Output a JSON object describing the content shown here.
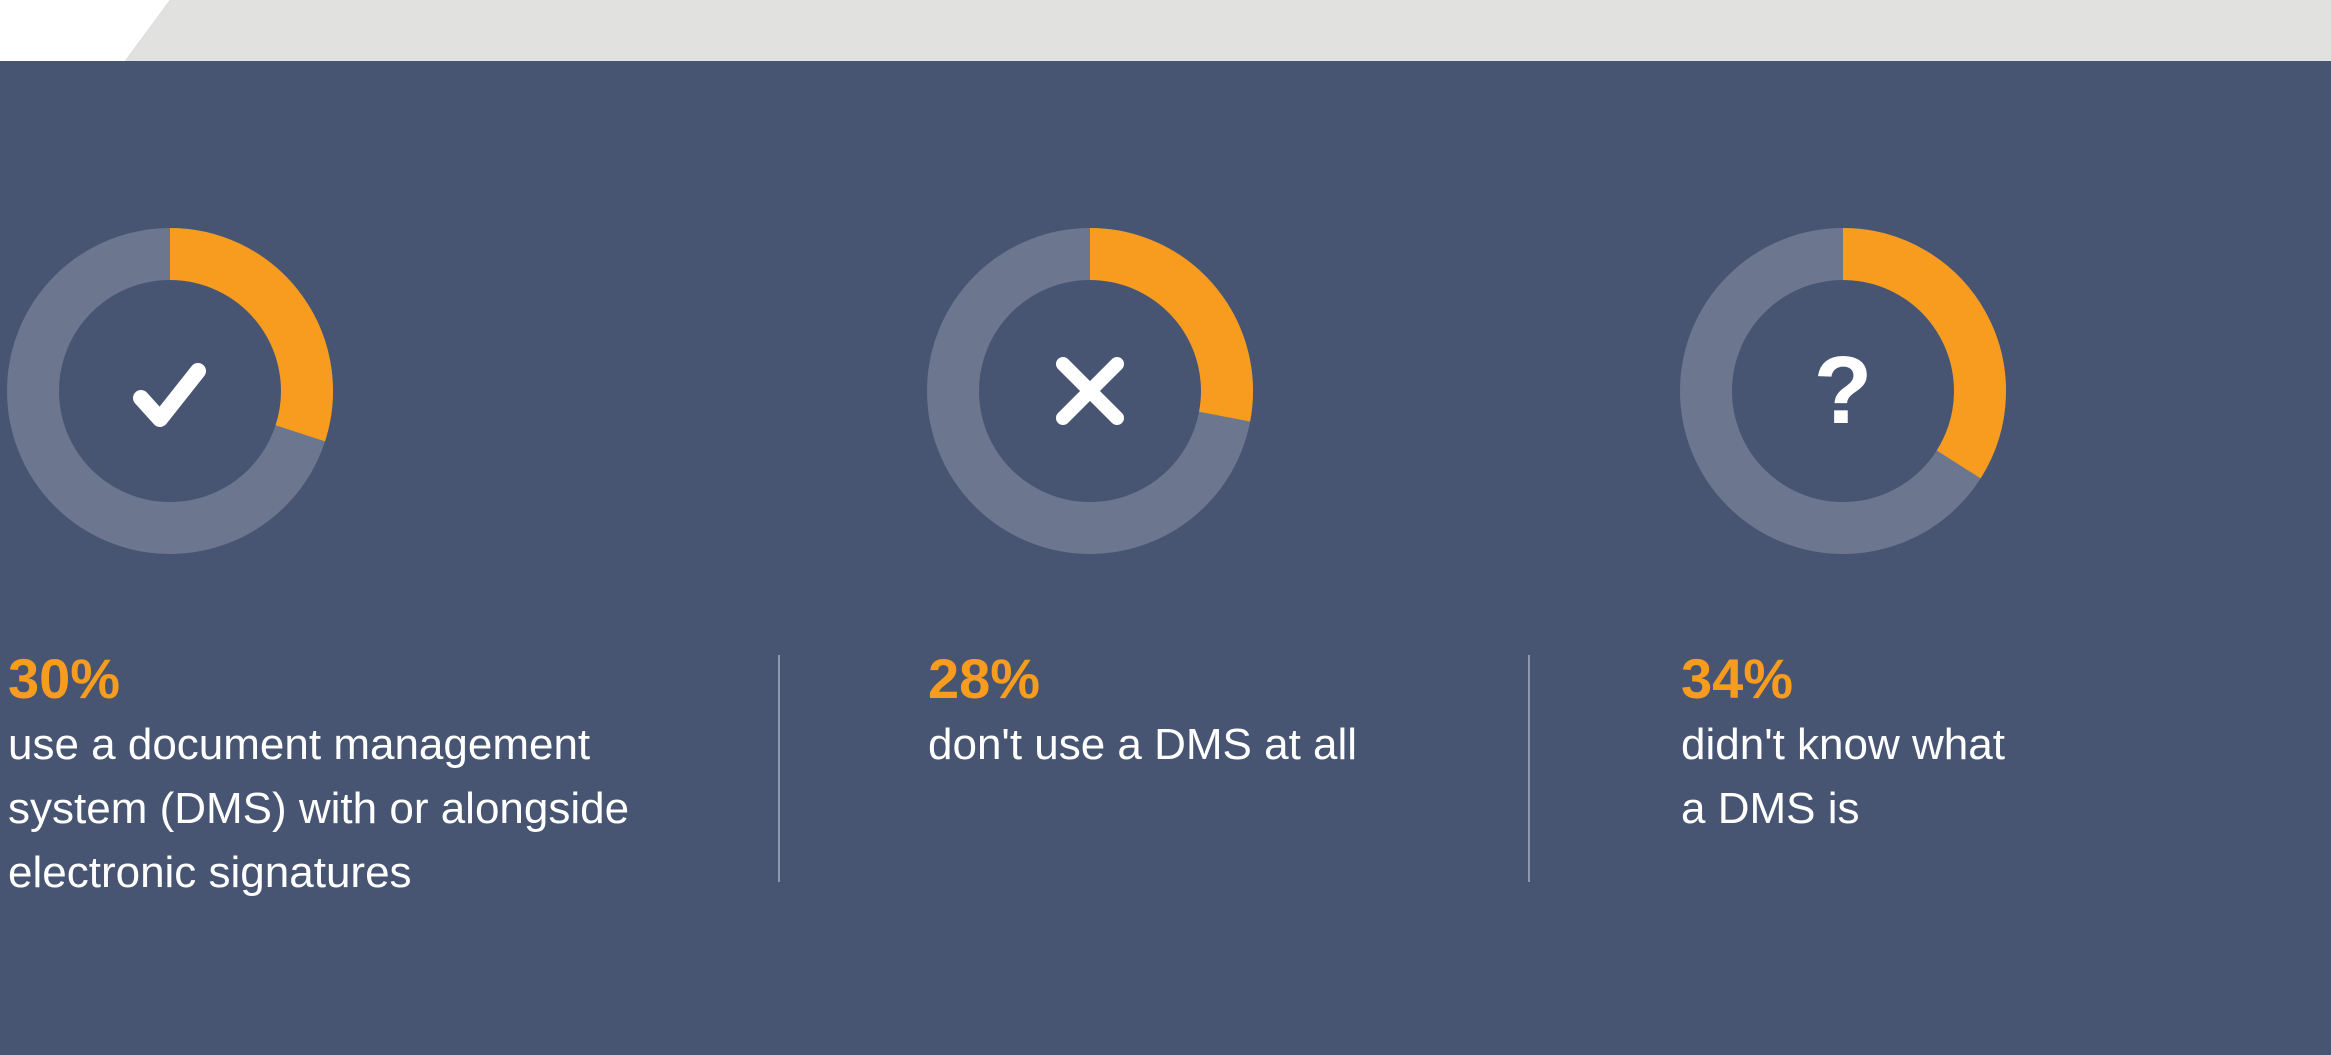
{
  "colors": {
    "background": "#475573",
    "accent": "#f79c1e",
    "ring_track": "#6c768f",
    "top_band": "#e1e1df",
    "text": "#ffffff"
  },
  "chart_data": {
    "type": "donut",
    "items": [
      {
        "value": 30,
        "value_label": "30%",
        "icon": "check-icon",
        "description": "use a document management system (DMS) with or alongside electronic signatures"
      },
      {
        "value": 28,
        "value_label": "28%",
        "icon": "x-icon",
        "description": "don't use a DMS at all"
      },
      {
        "value": 34,
        "value_label": "34%",
        "icon": "question-icon",
        "icon_glyph": "?",
        "description": "didn't know what a DMS is"
      }
    ]
  }
}
